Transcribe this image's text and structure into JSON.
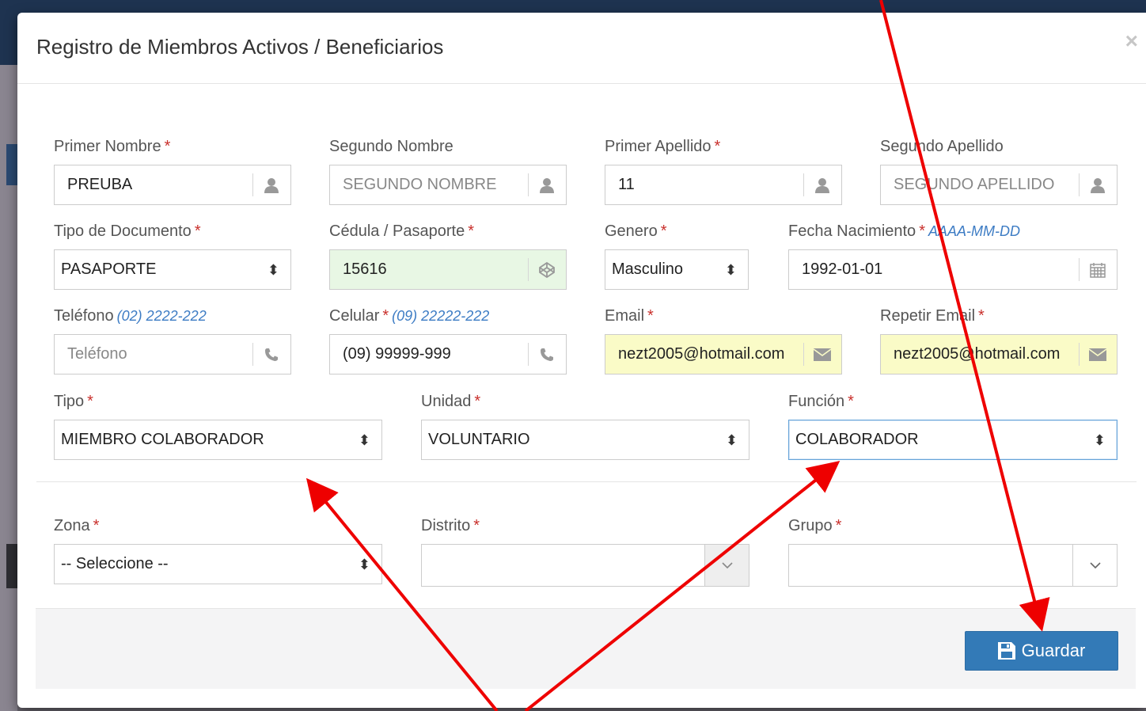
{
  "modal": {
    "title": "Registro de Miembros Activos / Beneficiarios",
    "close_label": "×"
  },
  "fields": {
    "primer_nombre": {
      "label": "Primer Nombre",
      "required": "*",
      "value": "PREUBA",
      "icon": "user-icon"
    },
    "segundo_nombre": {
      "label": "Segundo Nombre",
      "placeholder": "SEGUNDO NOMBRE",
      "icon": "user-icon"
    },
    "primer_apellido": {
      "label": "Primer Apellido",
      "required": "*",
      "value": "11",
      "icon": "user-icon"
    },
    "segundo_apellido": {
      "label": "Segundo Apellido",
      "placeholder": "SEGUNDO APELLIDO",
      "icon": "user-icon"
    },
    "tipo_documento": {
      "label": "Tipo de Documento",
      "required": "*",
      "value": "PASAPORTE"
    },
    "cedula": {
      "label": "Cédula / Pasaporte",
      "required": "*",
      "value": "15616",
      "icon": "codepen-icon",
      "state_color": "#e8f7e4"
    },
    "genero": {
      "label": "Genero",
      "required": "*",
      "value": "Masculino"
    },
    "fecha_nacimiento": {
      "label": "Fecha Nacimiento",
      "required": "*",
      "hint": "AAAA-MM-DD",
      "value": "1992-01-01",
      "icon": "calendar-icon"
    },
    "telefono": {
      "label": "Teléfono",
      "hint": "(02) 2222-222",
      "placeholder": "Teléfono",
      "icon": "phone-icon"
    },
    "celular": {
      "label": "Celular",
      "required": "*",
      "hint": "(09) 22222-222",
      "value": "(09) 99999-999",
      "icon": "phone-icon"
    },
    "email": {
      "label": "Email",
      "required": "*",
      "value": "nezt2005@hotmail.com",
      "icon": "envelope-icon",
      "state_color": "#fafbc7"
    },
    "repetir_email": {
      "label": "Repetir Email",
      "required": "*",
      "value": "nezt2005@hotmail.com",
      "icon": "envelope-icon"
    },
    "tipo": {
      "label": "Tipo",
      "required": "*",
      "value": "MIEMBRO COLABORADOR"
    },
    "unidad": {
      "label": "Unidad",
      "required": "*",
      "value": "VOLUNTARIO"
    },
    "funcion": {
      "label": "Función",
      "required": "*",
      "value": "COLABORADOR"
    },
    "zona": {
      "label": "Zona",
      "required": "*",
      "value": "-- Seleccione --"
    },
    "distrito": {
      "label": "Distrito",
      "required": "*",
      "value": ""
    },
    "grupo": {
      "label": "Grupo",
      "required": "*",
      "value": ""
    }
  },
  "footer": {
    "save_label": "Guardar",
    "save_color": "#337ab7"
  },
  "annotation": {
    "arrow_color": "#ee0000"
  }
}
